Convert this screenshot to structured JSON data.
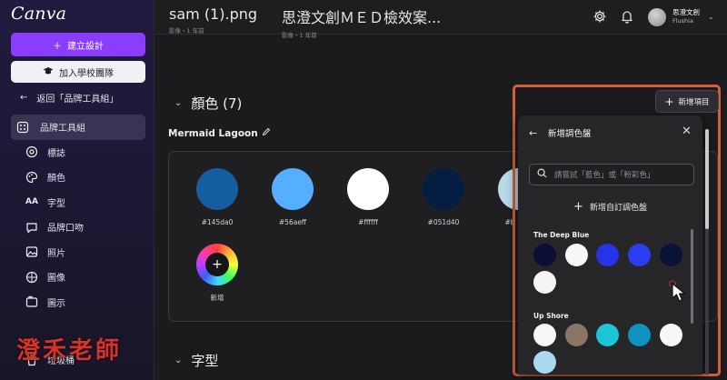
{
  "app": {
    "logo": "Canva"
  },
  "sidebar": {
    "create_label": "建立設計",
    "join_label": "加入學校團隊",
    "back_label": "返回「品牌工具組」",
    "items": [
      {
        "label": "品牌工具組",
        "icon": "brand-kit-icon",
        "active": true
      },
      {
        "label": "標誌",
        "icon": "logo-icon"
      },
      {
        "label": "顏色",
        "icon": "palette-icon"
      },
      {
        "label": "字型",
        "icon": "font-icon"
      },
      {
        "label": "品牌口吻",
        "icon": "chat-icon"
      },
      {
        "label": "照片",
        "icon": "photo-icon"
      },
      {
        "label": "圖像",
        "icon": "graphics-icon"
      },
      {
        "label": "圖示",
        "icon": "icons-icon"
      }
    ],
    "trash_label": "垃圾桶",
    "watermark": "澄禾老師"
  },
  "topbar": {
    "files": [
      {
        "name": "sam (1).png",
        "meta": "影像・1 年前"
      },
      {
        "name": "思澄文創ＭＥＤ檢效案...",
        "meta": "影像・1 年前"
      }
    ],
    "user": {
      "name": "思澄文創",
      "team": "Flushia"
    }
  },
  "main": {
    "colors_section_title": "顏色 (7)",
    "palette_name": "Mermaid Lagoon",
    "swatches": [
      {
        "hex": "#145da0",
        "label": "#145da0"
      },
      {
        "hex": "#56aeff",
        "label": "#56aeff"
      },
      {
        "hex": "#ffffff",
        "label": "#ffffff"
      },
      {
        "hex": "#051d40",
        "label": "#051d40"
      },
      {
        "hex": "#b7dbe8",
        "label": "#b"
      }
    ],
    "add_color_label": "新增",
    "fonts_section_title": "字型"
  },
  "panel": {
    "add_item_label": "新增項目",
    "title": "新增調色盤",
    "search_placeholder": "請嘗試「藍色」或「粉彩色」",
    "add_custom_label": "新增自訂調色盤",
    "groups": [
      {
        "title": "The Deep Blue",
        "colors": [
          "#0b0f35",
          "#f7f7f7",
          "#2434e6",
          "#2a3ef0",
          "#0a1238",
          "#f5f5f5"
        ]
      },
      {
        "title": "Up Shore",
        "colors": [
          "#f7f7f7",
          "#8a7567",
          "#1cc6d6",
          "#0f93bf",
          "#f7f7f7",
          "#a9d9ee"
        ]
      }
    ]
  },
  "colors": {
    "accent": "#8b3dff",
    "highlight": "#d2603f"
  }
}
